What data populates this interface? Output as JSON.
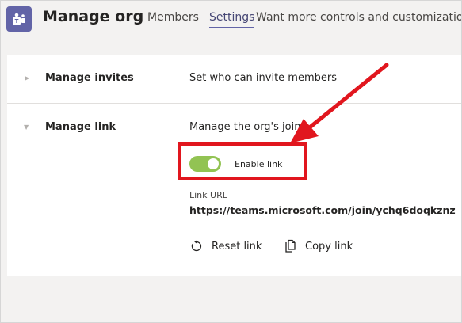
{
  "header": {
    "app_icon": "teams-org-icon",
    "title": "Manage org",
    "tabs": [
      {
        "label": "Members",
        "active": false
      },
      {
        "label": "Settings",
        "active": true
      }
    ],
    "promo_text": "Want more controls and customization?"
  },
  "settings": {
    "rows": [
      {
        "label": "Manage invites",
        "description": "Set who can invite members",
        "expanded": false
      },
      {
        "label": "Manage link",
        "description": "Manage the org's join l",
        "expanded": true
      }
    ],
    "link": {
      "toggle_label": "Enable link",
      "toggle_on": true,
      "url_caption": "Link URL",
      "url": "https://teams.microsoft.com/join/ychq6doqkznz",
      "reset_label": "Reset link",
      "copy_label": "Copy link"
    }
  },
  "colors": {
    "accent": "#6264a7",
    "toggle_on": "#92c353",
    "annotation": "#e1161e"
  }
}
